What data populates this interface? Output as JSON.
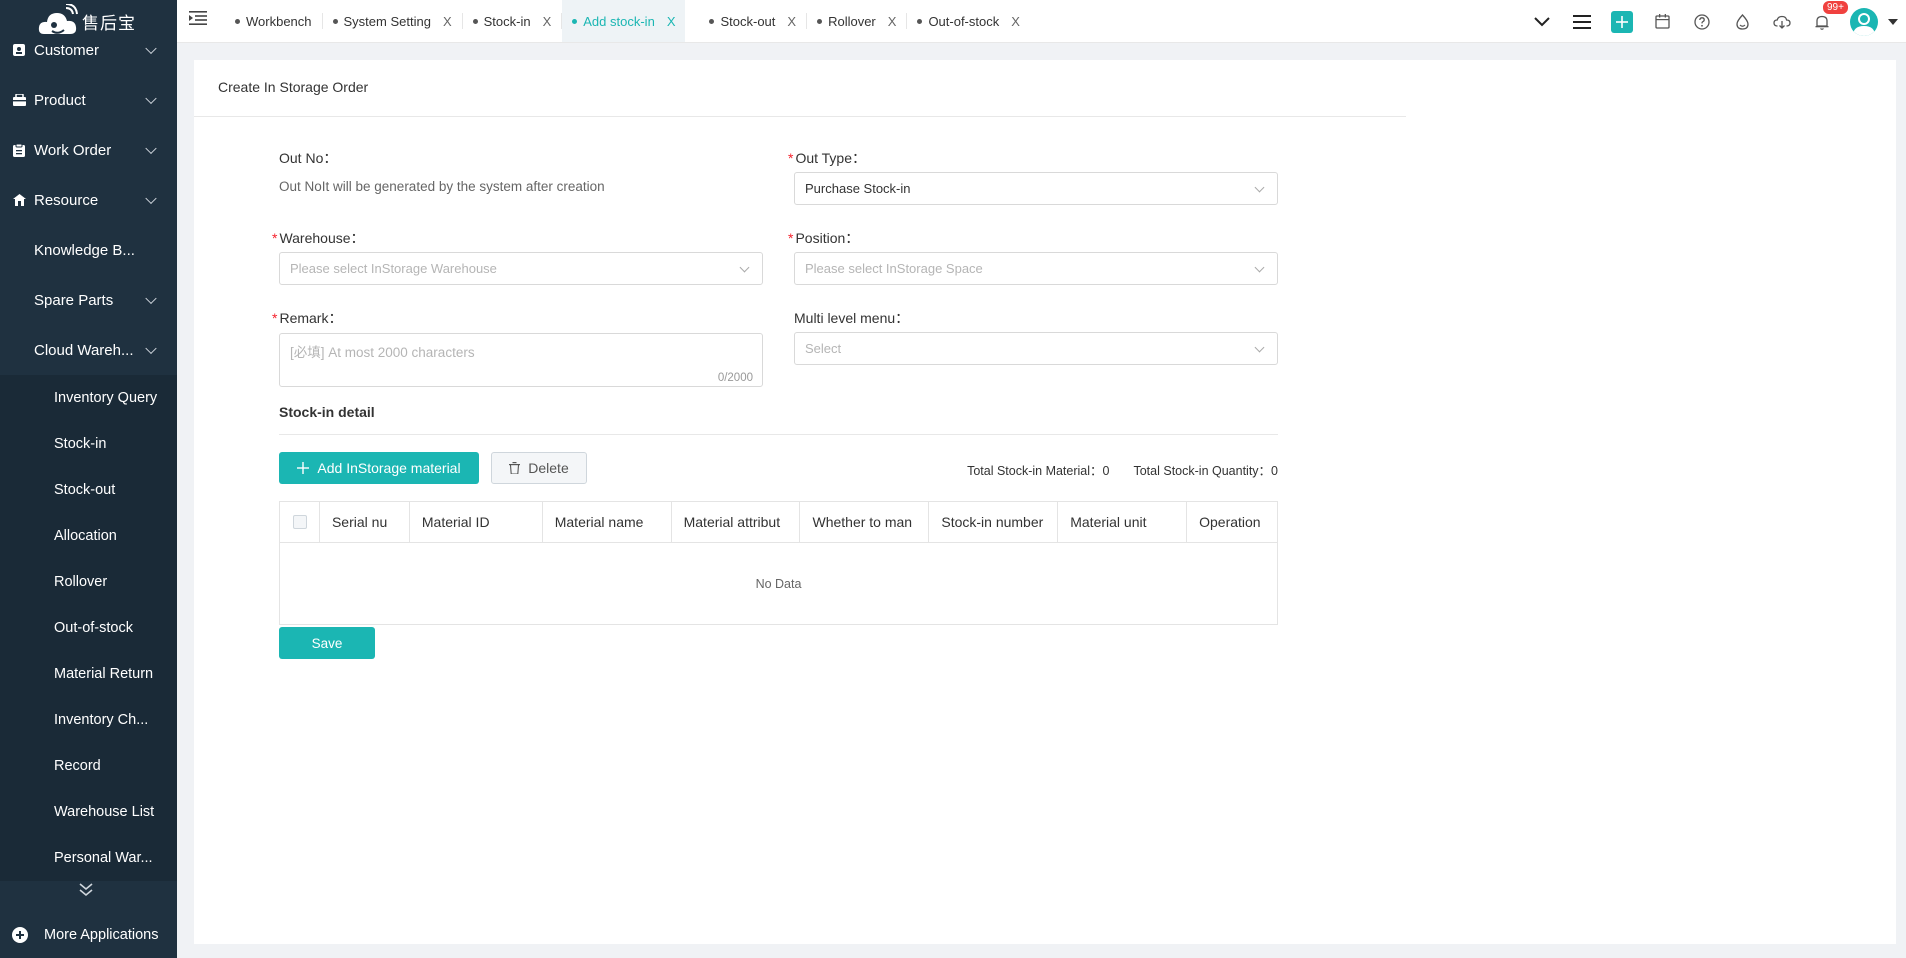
{
  "app": {
    "logo_text": "售后宝"
  },
  "sidebar": {
    "items": [
      {
        "label": "Customer",
        "icon": "customer-icon"
      },
      {
        "label": "Product",
        "icon": "product-icon"
      },
      {
        "label": "Work Order",
        "icon": "work-order-icon"
      },
      {
        "label": "Resource",
        "icon": "resource-icon"
      }
    ],
    "sub_items": [
      {
        "label": "Knowledge B..."
      },
      {
        "label": "Spare Parts"
      },
      {
        "label": "Cloud Wareh..."
      }
    ],
    "sub2_items": [
      {
        "label": "Inventory Query"
      },
      {
        "label": "Stock-in"
      },
      {
        "label": "Stock-out"
      },
      {
        "label": "Allocation"
      },
      {
        "label": "Rollover"
      },
      {
        "label": "Out-of-stock"
      },
      {
        "label": "Material Return"
      },
      {
        "label": "Inventory Ch..."
      },
      {
        "label": "Record"
      },
      {
        "label": "Warehouse List"
      },
      {
        "label": "Personal War..."
      }
    ],
    "more_apps": "More Applications"
  },
  "tabs": [
    {
      "label": "Workbench"
    },
    {
      "label": "System Setting"
    },
    {
      "label": "Stock-in"
    },
    {
      "label": "Add stock-in"
    },
    {
      "label": "Stock-out"
    },
    {
      "label": "Rollover"
    },
    {
      "label": "Out-of-stock"
    }
  ],
  "tab_close": "X",
  "header": {
    "notification_badge": "99+"
  },
  "page": {
    "title": "Create In Storage Order"
  },
  "form": {
    "out_no": {
      "label": "Out No：",
      "help": "Out NoIt will be generated by the system after creation"
    },
    "out_type": {
      "label": "Out Type：",
      "value": "Purchase Stock-in"
    },
    "warehouse": {
      "label": "Warehouse：",
      "placeholder": "Please select InStorage Warehouse"
    },
    "position": {
      "label": "Position：",
      "placeholder": "Please select InStorage Space"
    },
    "remark": {
      "label": "Remark：",
      "placeholder": "[必填] At most 2000 characters",
      "count": "0/2000"
    },
    "multi_level": {
      "label": "Multi level menu：",
      "placeholder": "Select"
    }
  },
  "detail": {
    "title": "Stock-in detail",
    "add_button": "Add InStorage material",
    "delete_button": "Delete",
    "total_material_label": "Total Stock-in Material：",
    "total_material_value": "0",
    "total_quantity_label": "Total Stock-in Quantity：",
    "total_quantity_value": "0",
    "columns": [
      "Serial nu",
      "Material ID",
      "Material name",
      "Material attribut",
      "Whether to man",
      "Stock-in number",
      "Material unit",
      "Operation"
    ],
    "empty_text": "No Data"
  },
  "save_button": "Save",
  "colors": {
    "accent": "#1bb6b3",
    "sidebar": "#1f3140",
    "required": "#f5222d",
    "badge": "#f0413f"
  }
}
